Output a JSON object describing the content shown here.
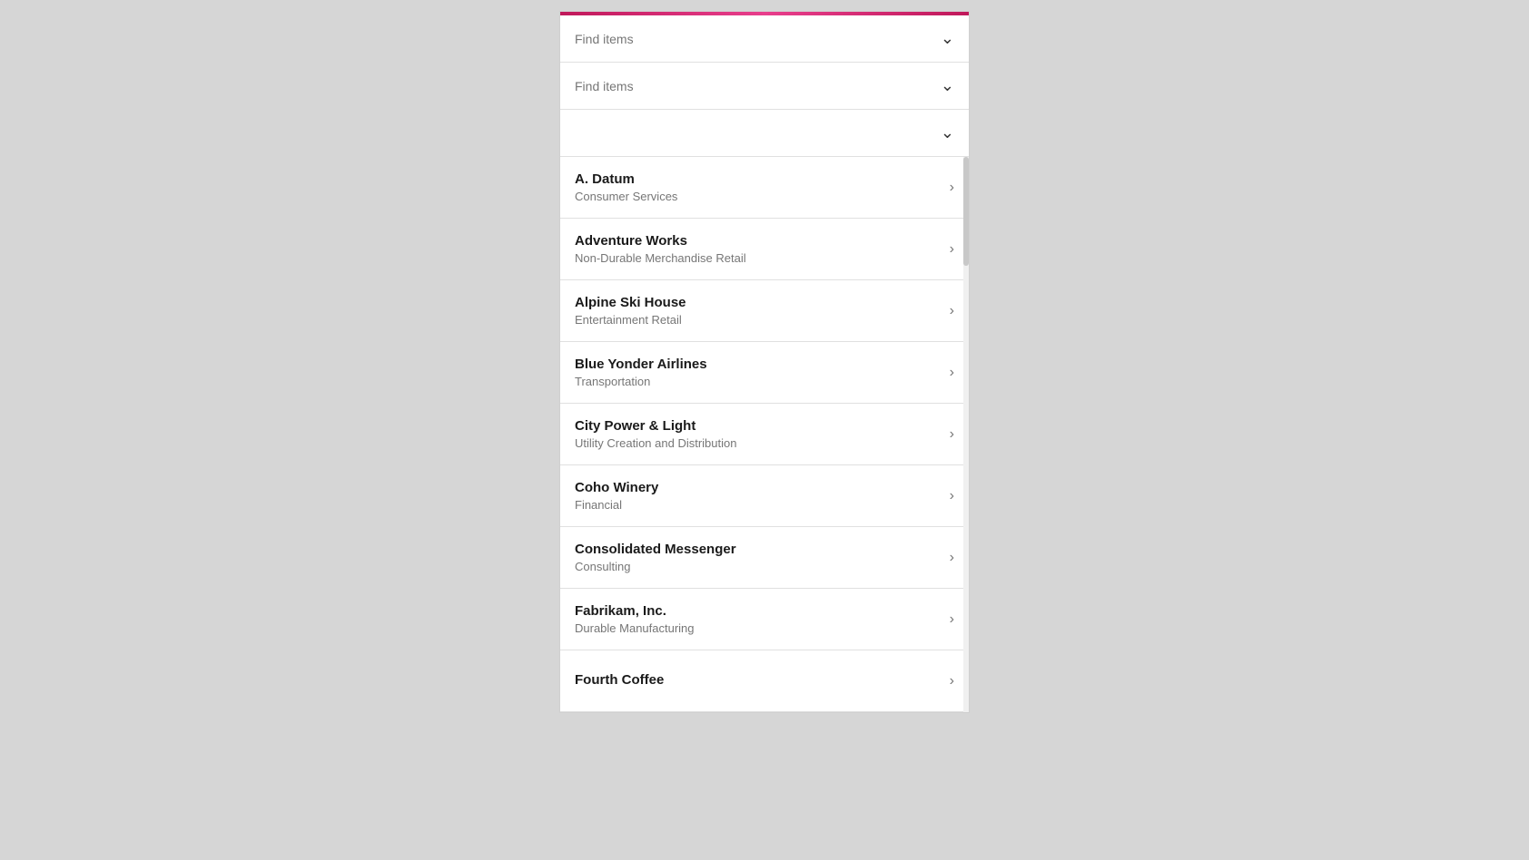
{
  "filters": [
    {
      "id": "filter1",
      "placeholder": "Find items",
      "hasValue": false
    },
    {
      "id": "filter2",
      "placeholder": "Find items",
      "hasValue": false
    },
    {
      "id": "filter3",
      "placeholder": "",
      "hasValue": false
    }
  ],
  "listItems": [
    {
      "id": "item-a-datum",
      "name": "A. Datum",
      "subtitle": "Consumer Services"
    },
    {
      "id": "item-adventure-works",
      "name": "Adventure Works",
      "subtitle": "Non-Durable Merchandise Retail"
    },
    {
      "id": "item-alpine-ski-house",
      "name": "Alpine Ski House",
      "subtitle": "Entertainment Retail"
    },
    {
      "id": "item-blue-yonder-airlines",
      "name": "Blue Yonder Airlines",
      "subtitle": "Transportation"
    },
    {
      "id": "item-city-power-light",
      "name": "City Power & Light",
      "subtitle": "Utility Creation and Distribution"
    },
    {
      "id": "item-coho-winery",
      "name": "Coho Winery",
      "subtitle": "Financial"
    },
    {
      "id": "item-consolidated-messenger",
      "name": "Consolidated Messenger",
      "subtitle": "Consulting"
    },
    {
      "id": "item-fabrikam-inc",
      "name": "Fabrikam, Inc.",
      "subtitle": "Durable Manufacturing"
    },
    {
      "id": "item-fourth-coffee",
      "name": "Fourth Coffee",
      "subtitle": ""
    }
  ],
  "chevronDown": "⌄",
  "chevronRight": "›"
}
